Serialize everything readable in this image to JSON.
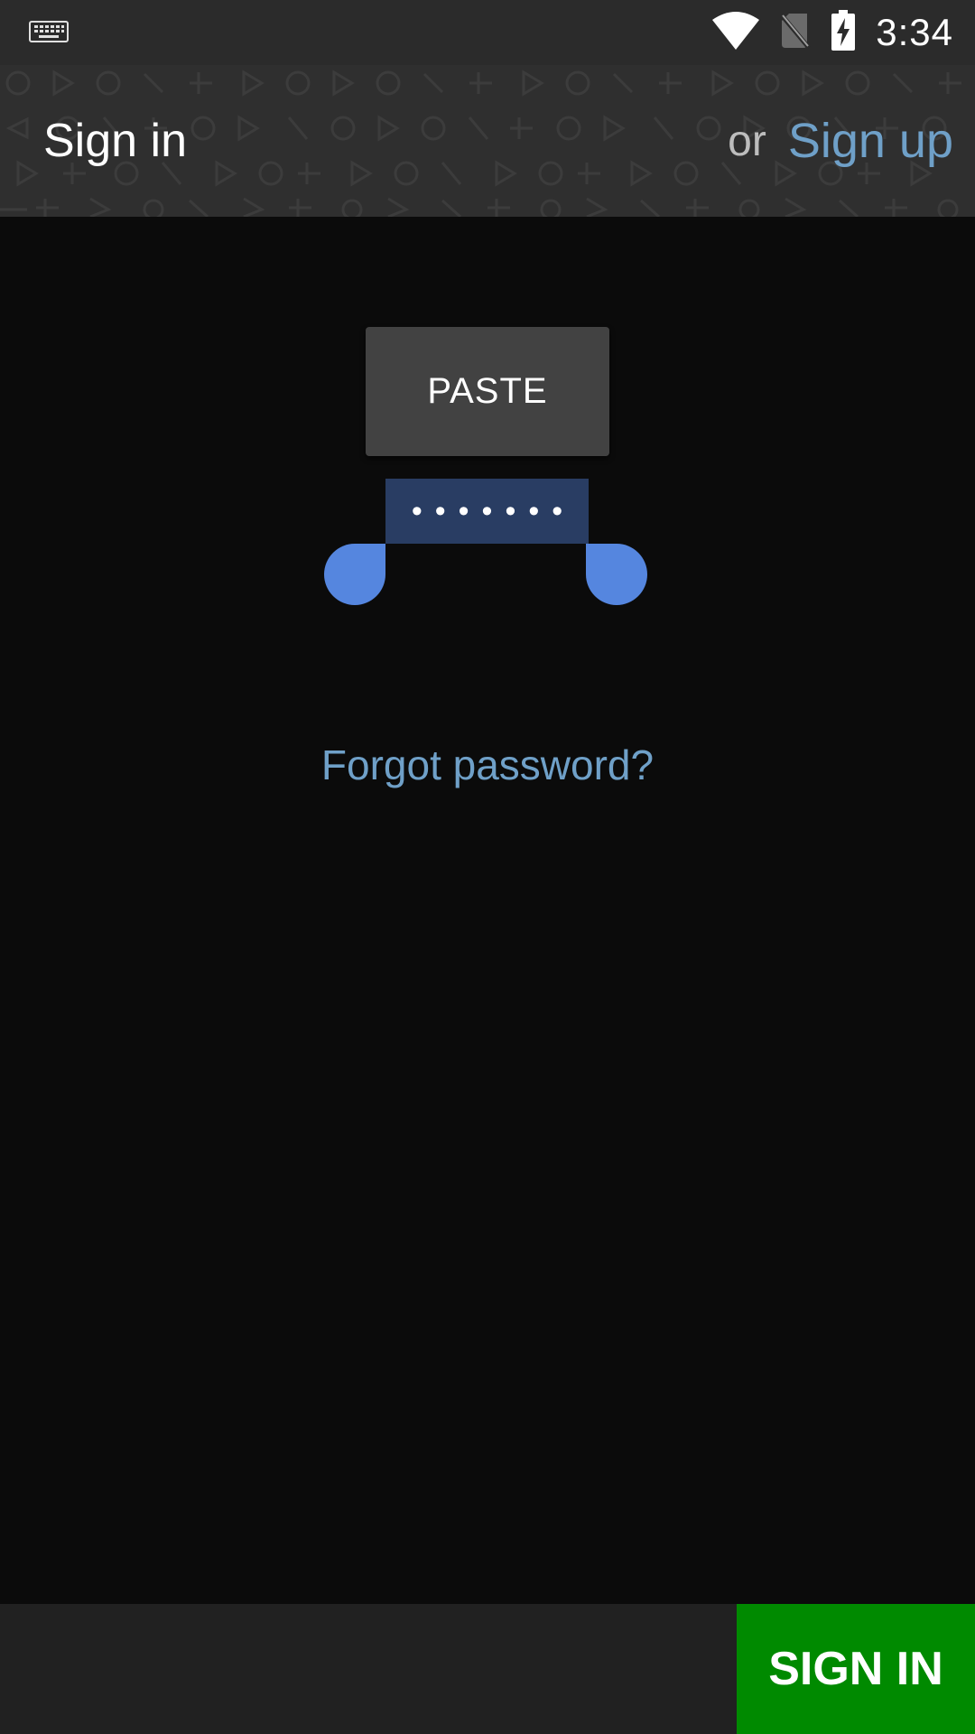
{
  "status_bar": {
    "time": "3:34",
    "icons": [
      "keyboard-icon",
      "wifi-icon",
      "no-sim-icon",
      "battery-charging-icon"
    ]
  },
  "header": {
    "title": "Sign in",
    "or_text": "or",
    "signup_label": "Sign up"
  },
  "context_menu": {
    "paste_label": "PASTE"
  },
  "password": {
    "masked_value": "•••••••"
  },
  "forgot_password_label": "Forgot password?",
  "bottom_bar": {
    "signin_label": "SIGN IN"
  },
  "colors": {
    "accent_link": "#6fa0c8",
    "signin_green": "#008a00",
    "selection": "#293d63",
    "handle": "#5586df"
  }
}
